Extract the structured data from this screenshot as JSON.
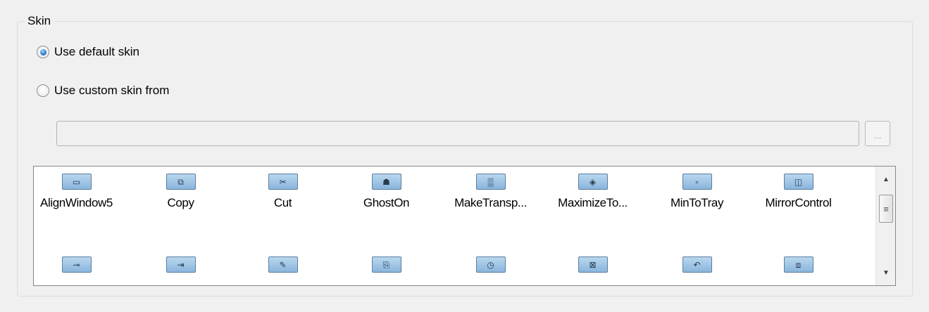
{
  "skin_group": {
    "legend": "Skin",
    "default_option": {
      "label": "Use default skin",
      "selected": true
    },
    "custom_option": {
      "label": "Use custom skin from",
      "selected": false
    },
    "custom_path": {
      "value": "",
      "placeholder": ""
    },
    "browse_label": "...",
    "colors": {
      "tile_top": "#b9d7ef",
      "tile_bottom": "#8ab5dc",
      "radio_selected": "#2f7fd1"
    }
  },
  "skin_list": {
    "row1": [
      {
        "label": "AlignWindow5",
        "icon": "window-frame-icon",
        "glyph": "▭"
      },
      {
        "label": "Copy",
        "icon": "copy-icon",
        "glyph": "⧉"
      },
      {
        "label": "Cut",
        "icon": "scissors-icon",
        "glyph": "✂"
      },
      {
        "label": "GhostOn",
        "icon": "ghost-icon",
        "glyph": "☗"
      },
      {
        "label": "MakeTransp...",
        "icon": "transparency-grid-icon",
        "glyph": "▒"
      },
      {
        "label": "MaximizeTo...",
        "icon": "maximize-arrows-icon",
        "glyph": "◈"
      },
      {
        "label": "MinToTray",
        "icon": "minimize-square-icon",
        "glyph": "▫"
      },
      {
        "label": "MirrorControl",
        "icon": "mirror-windows-icon",
        "glyph": "◫"
      }
    ],
    "row2": [
      {
        "icon": "handle-icon",
        "glyph": "⊸"
      },
      {
        "icon": "enter-arrow-icon",
        "glyph": "⇥"
      },
      {
        "icon": "edit-icon",
        "glyph": "✎"
      },
      {
        "icon": "clipboard-icon",
        "glyph": "⎘"
      },
      {
        "icon": "clock-icon",
        "glyph": "◷"
      },
      {
        "icon": "resize-icon",
        "glyph": "⊠"
      },
      {
        "icon": "undo-arrow-icon",
        "glyph": "↶"
      },
      {
        "icon": "cycle-icon",
        "glyph": "⧈"
      }
    ],
    "scrollbar": {
      "up_icon": "arrow-up-icon",
      "down_icon": "arrow-down-icon",
      "thumb_icon": "grip-icon"
    }
  }
}
